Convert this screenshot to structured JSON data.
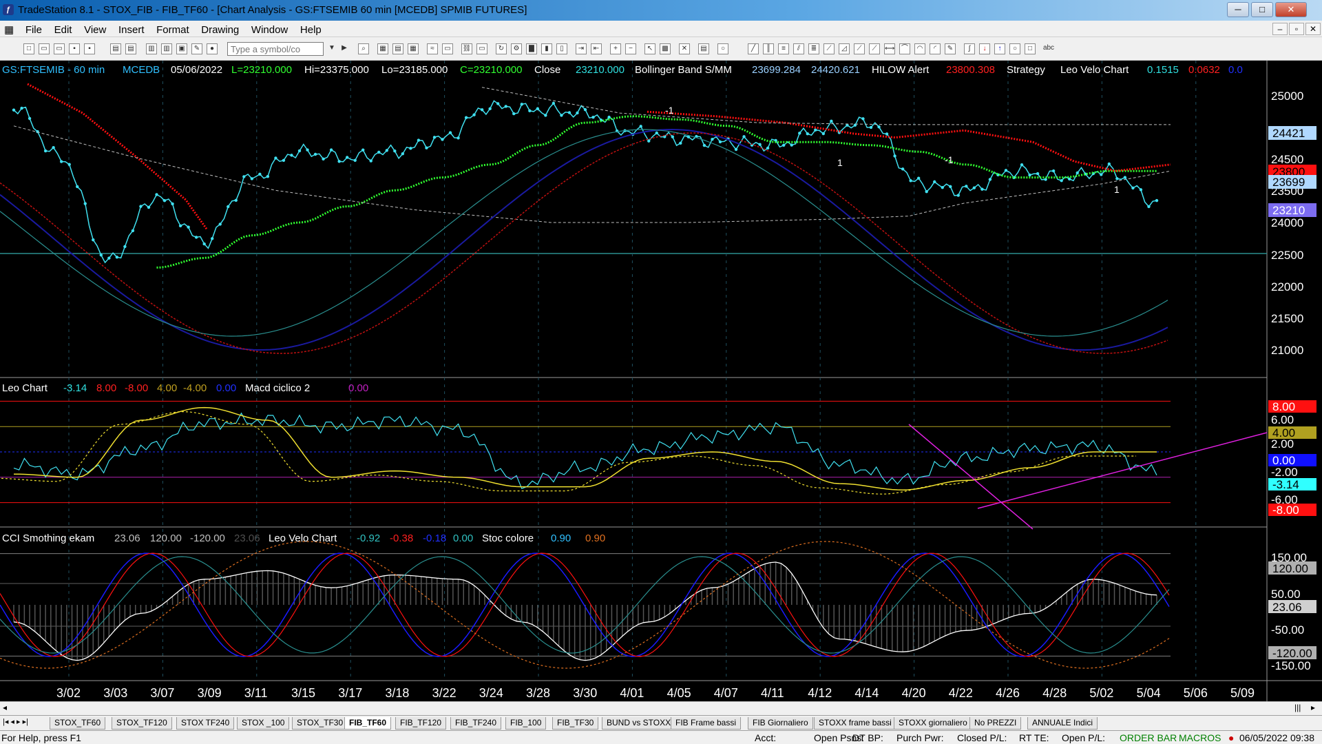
{
  "window": {
    "title": "TradeStation 8.1 - STOX_FIB - FIB_TF60 - [Chart Analysis - GS:FTSEMIB  60 min  [MCEDB] SPMIB FUTURES]",
    "min_label": "─",
    "max_label": "□",
    "close_label": "✕"
  },
  "menu": {
    "items": [
      "File",
      "Edit",
      "View",
      "Insert",
      "Format",
      "Drawing",
      "Window",
      "Help"
    ],
    "mdi_min": "–",
    "mdi_restore": "▫",
    "mdi_close": "✕"
  },
  "toolbar": {
    "symbol_placeholder": "Type a symbol/co",
    "text_tool": "abc"
  },
  "chart": {
    "header": {
      "symbol": "GS:FTSEMIB - 60 min",
      "feed": "MCEDB",
      "date": "05/06/2022",
      "last": "L=23210.000",
      "high": "Hi=23375.000",
      "low": "Lo=23185.000",
      "close": "C=23210.000",
      "close_label": "Close",
      "close_value": "23210.000",
      "bb_name": "Bollinger Band S/MM",
      "bb_v1": "23699.284",
      "bb_v2": "24420.621",
      "hl_name": "HILOW Alert",
      "hl_v1": "23800.308",
      "strategy": "Strategy",
      "leo_name": "Leo Velo Chart",
      "leo_v1": "0.1515",
      "leo_v2": "0.0632",
      "leo_v3": "0.0"
    },
    "price_axis": [
      "25000",
      "24500",
      "24000",
      "23500",
      "23000",
      "22500",
      "22000",
      "21500",
      "21000"
    ],
    "price_badges": {
      "bb_upper": "24421",
      "hl": "23800",
      "bb_mid": "23699",
      "last": "23210"
    },
    "panel2": {
      "name": "Leo Chart",
      "v1": "-3.14",
      "v2": "8.00",
      "v3": "-8.00",
      "v4": "4.00",
      "v5": "-4.00",
      "v6": "0.00",
      "macd_name": "Macd ciclico 2",
      "macd_v1": "0.00",
      "axis": [
        "6.00",
        "2.00",
        "-2.00",
        "-6.00"
      ],
      "badges": [
        "8.00",
        "4.00",
        "0.00",
        "-3.14",
        "-8.00"
      ]
    },
    "panel3": {
      "name": "CCI Smothing ekam",
      "v1": "23.06",
      "v2": "120.00",
      "v3": "-120.00",
      "v4": "23.06",
      "leo_name": "Leo Velo Chart",
      "leo_v1": "-0.92",
      "leo_v2": "-0.38",
      "leo_v3": "-0.18",
      "leo_v4": "0.00",
      "stoc_name": "Stoc colore",
      "stoc_v1": "0.90",
      "stoc_v2": "0.90",
      "axis": [
        "150.00",
        "50.00",
        "-50.00",
        "-150.00"
      ],
      "badges": [
        "120.00",
        "23.06",
        "-120.00"
      ]
    },
    "markers": {
      "m1": "-1",
      "m2": "1",
      "m3": "-1",
      "m4": "1",
      "m5": "1"
    },
    "x_axis": [
      "3/02",
      "3/03",
      "3/07",
      "3/09",
      "3/11",
      "3/15",
      "3/17",
      "3/18",
      "3/22",
      "3/24",
      "3/28",
      "3/30",
      "4/01",
      "4/05",
      "4/07",
      "4/11",
      "4/12",
      "4/14",
      "4/20",
      "4/22",
      "4/26",
      "4/28",
      "5/02",
      "5/04",
      "5/06",
      "5/09"
    ]
  },
  "chart_data": [
    {
      "type": "line",
      "title": "GS:FTSEMIB - 60 min",
      "x": [
        "3/02",
        "3/03",
        "3/07",
        "3/09",
        "3/11",
        "3/15",
        "3/17",
        "3/18",
        "3/22",
        "3/24",
        "3/28",
        "3/30",
        "4/01",
        "4/05",
        "4/07",
        "4/11",
        "4/12",
        "4/14",
        "4/20",
        "4/22",
        "4/26",
        "4/28",
        "5/02",
        "5/04",
        "5/06"
      ],
      "ylim": [
        20600,
        25200
      ],
      "series": [
        {
          "name": "Close",
          "values": [
            24700,
            23900,
            22300,
            23300,
            22600,
            23600,
            24000,
            23900,
            24000,
            24200,
            24700,
            24650,
            24600,
            24300,
            24200,
            24150,
            24100,
            24350,
            24450,
            23500,
            23400,
            23700,
            23600,
            23700,
            23210
          ]
        },
        {
          "name": "Bollinger Band S/MM",
          "values": [
            null,
            null,
            null,
            22200,
            22350,
            22700,
            22900,
            23150,
            23400,
            23600,
            23800,
            24100,
            24450,
            24550,
            24500,
            24400,
            24150,
            24150,
            24100,
            24000,
            23800,
            23600,
            23600,
            23700,
            23699
          ]
        }
      ]
    },
    {
      "type": "line",
      "title": "Leo Chart",
      "x": [
        "3/02",
        "3/07",
        "3/11",
        "3/15",
        "3/18",
        "3/24",
        "3/28",
        "4/01",
        "4/05",
        "4/07",
        "4/12",
        "4/14",
        "4/20",
        "4/22",
        "4/26",
        "4/28",
        "5/02",
        "5/04",
        "5/06"
      ],
      "ylim": [
        -9,
        9
      ],
      "series": [
        {
          "name": "Leo Chart",
          "values": [
            -2.0,
            -3.5,
            0.5,
            4.5,
            5.0,
            4.0,
            5.0,
            3.5,
            -5.0,
            -2.5,
            0.5,
            2.5,
            4.0,
            -2.0,
            -4.5,
            -1.0,
            0.5,
            1.0,
            -3.14
          ]
        },
        {
          "name": "Macd ciclico 2",
          "values": [
            -3.5,
            -4.0,
            5.0,
            7.0,
            5.0,
            -4.0,
            -3.0,
            -4.0,
            -5.5,
            -5.5,
            -1.0,
            0.0,
            -1.5,
            -5.0,
            -6.0,
            -4.5,
            -2.5,
            0.0,
            0.0
          ]
        }
      ]
    },
    {
      "type": "line",
      "title": "CCI Smothing ekam",
      "x": [
        "3/02",
        "3/07",
        "3/11",
        "3/15",
        "3/18",
        "3/24",
        "3/28",
        "4/01",
        "4/05",
        "4/07",
        "4/12",
        "4/14",
        "4/20",
        "4/22",
        "4/26",
        "4/28",
        "5/02",
        "5/04",
        "5/06"
      ],
      "ylim": [
        -170,
        170
      ],
      "series": [
        {
          "name": "CCI Smothing ekam",
          "values": [
            -40,
            -130,
            -20,
            60,
            80,
            40,
            70,
            60,
            -40,
            -130,
            -40,
            40,
            100,
            -80,
            -110,
            -60,
            -20,
            60,
            23.06
          ]
        }
      ]
    }
  ],
  "tabs": [
    "STOX_TF60",
    "STOX_TF120",
    "STOX TF240",
    "STOX _100",
    "STOX_TF30",
    "FIB_TF60",
    "FIB_TF120",
    "FIB_TF240",
    "FIB_100",
    "FIB_TF30",
    "BUND vs STOXX",
    "FIB Frame bassi",
    "FIB Giornaliero",
    "STOXX frame bassi",
    "STOXX giornaliero",
    "No PREZZI",
    "ANNUALE Indici"
  ],
  "status": {
    "help": "For Help, press F1",
    "acct": "Acct:",
    "open_psns": "Open Psns:",
    "dt_bp": "DT BP:",
    "purch_pwr": "Purch Pwr:",
    "closed_pl": "Closed P/L:",
    "rt_te": "RT TE:",
    "open_pl": "Open P/L:",
    "order_bar": "ORDER BAR",
    "macros": "MACROS",
    "datetime": "06/05/2022 09:38"
  },
  "colors": {
    "price": "#40e0f0",
    "ma_red": "#ff1010",
    "ma_green": "#30ff30",
    "osc_blue": "#1a1aa0",
    "osc_red": "#c01010",
    "osc_teal": "#2a9090",
    "yellow": "#f0e030",
    "magenta": "#e020e0"
  }
}
